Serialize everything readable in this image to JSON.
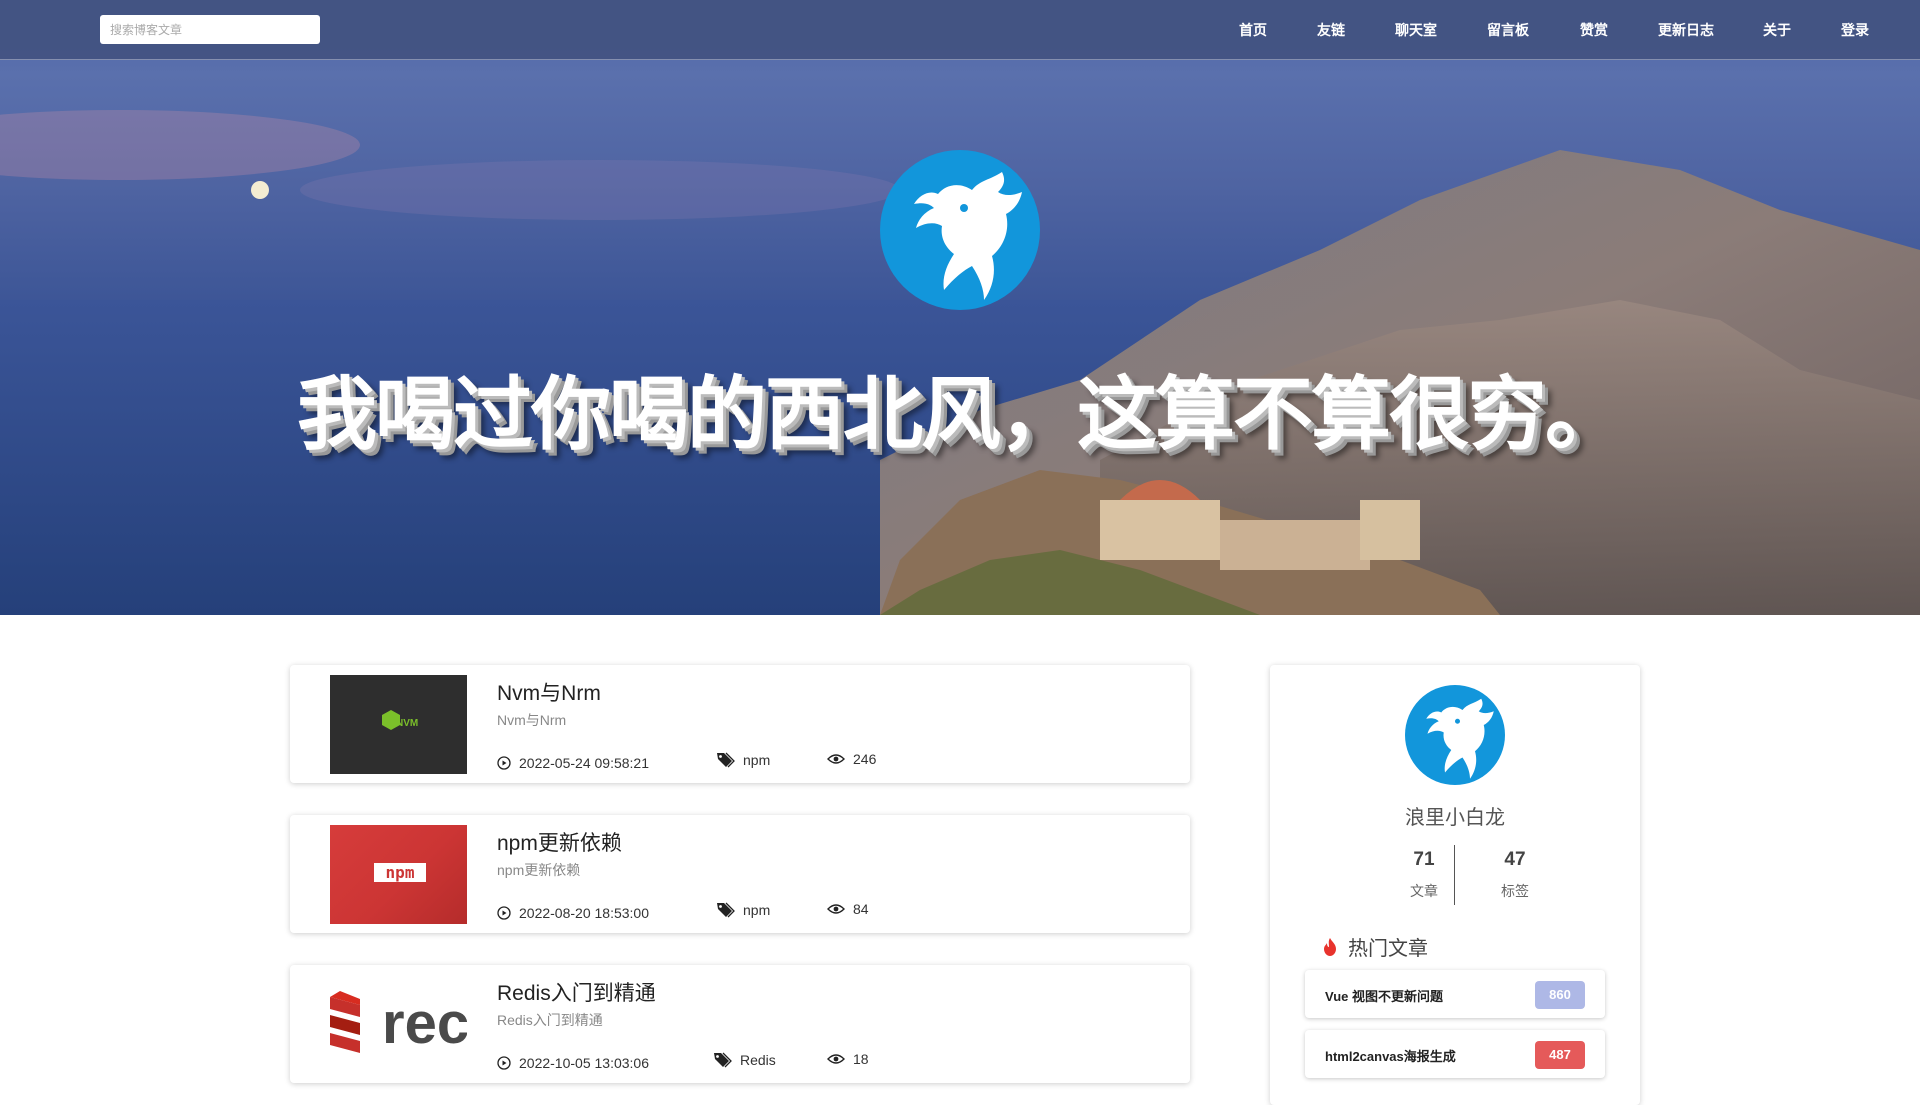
{
  "search": {
    "placeholder": "搜索博客文章"
  },
  "nav": [
    "首页",
    "友链",
    "聊天室",
    "留言板",
    "赞赏",
    "更新日志",
    "关于",
    "登录"
  ],
  "hero": {
    "title": "我喝过你喝的西北风，这算不算很穷。"
  },
  "articles": [
    {
      "title": "Nvm与Nrm",
      "subtitle": "Nvm与Nrm",
      "date": "2022-05-24 09:58:21",
      "tag": "npm",
      "views": "246",
      "thumb": {
        "text": "NVM",
        "bg": "#2e2e2e",
        "accent": "#7bbf2a"
      }
    },
    {
      "title": "npm更新依赖",
      "subtitle": "npm更新依赖",
      "date": "2022-08-20 18:53:00",
      "tag": "npm",
      "views": "84",
      "thumb": {
        "text": "npm",
        "bg": "#cc3534"
      }
    },
    {
      "title": "Redis入门到精通",
      "subtitle": "Redis入门到精通",
      "date": "2022-10-05 13:03:06",
      "tag": "Redis",
      "views": "18",
      "thumb": {
        "text": "rec",
        "bg": "#ffffff",
        "accent": "#c6302b"
      }
    }
  ],
  "profile": {
    "name": "浪里小白龙",
    "posts": {
      "value": "71",
      "label": "文章"
    },
    "tags": {
      "value": "47",
      "label": "标签"
    }
  },
  "hot": {
    "heading": "热门文章",
    "items": [
      {
        "title": "Vue 视图不更新问题",
        "count": "860",
        "color": "#aeb8e6"
      },
      {
        "title": "html2canvas海报生成",
        "count": "487",
        "color": "#e55a5a"
      }
    ]
  },
  "icons": {
    "logo": "dragon-logo-icon",
    "date": "play-circle-icon",
    "tag": "tag-icon",
    "views": "eye-icon",
    "hot": "flame-icon"
  },
  "colors": {
    "brand_blue": "#1296db",
    "nav_bg": "#425280"
  }
}
